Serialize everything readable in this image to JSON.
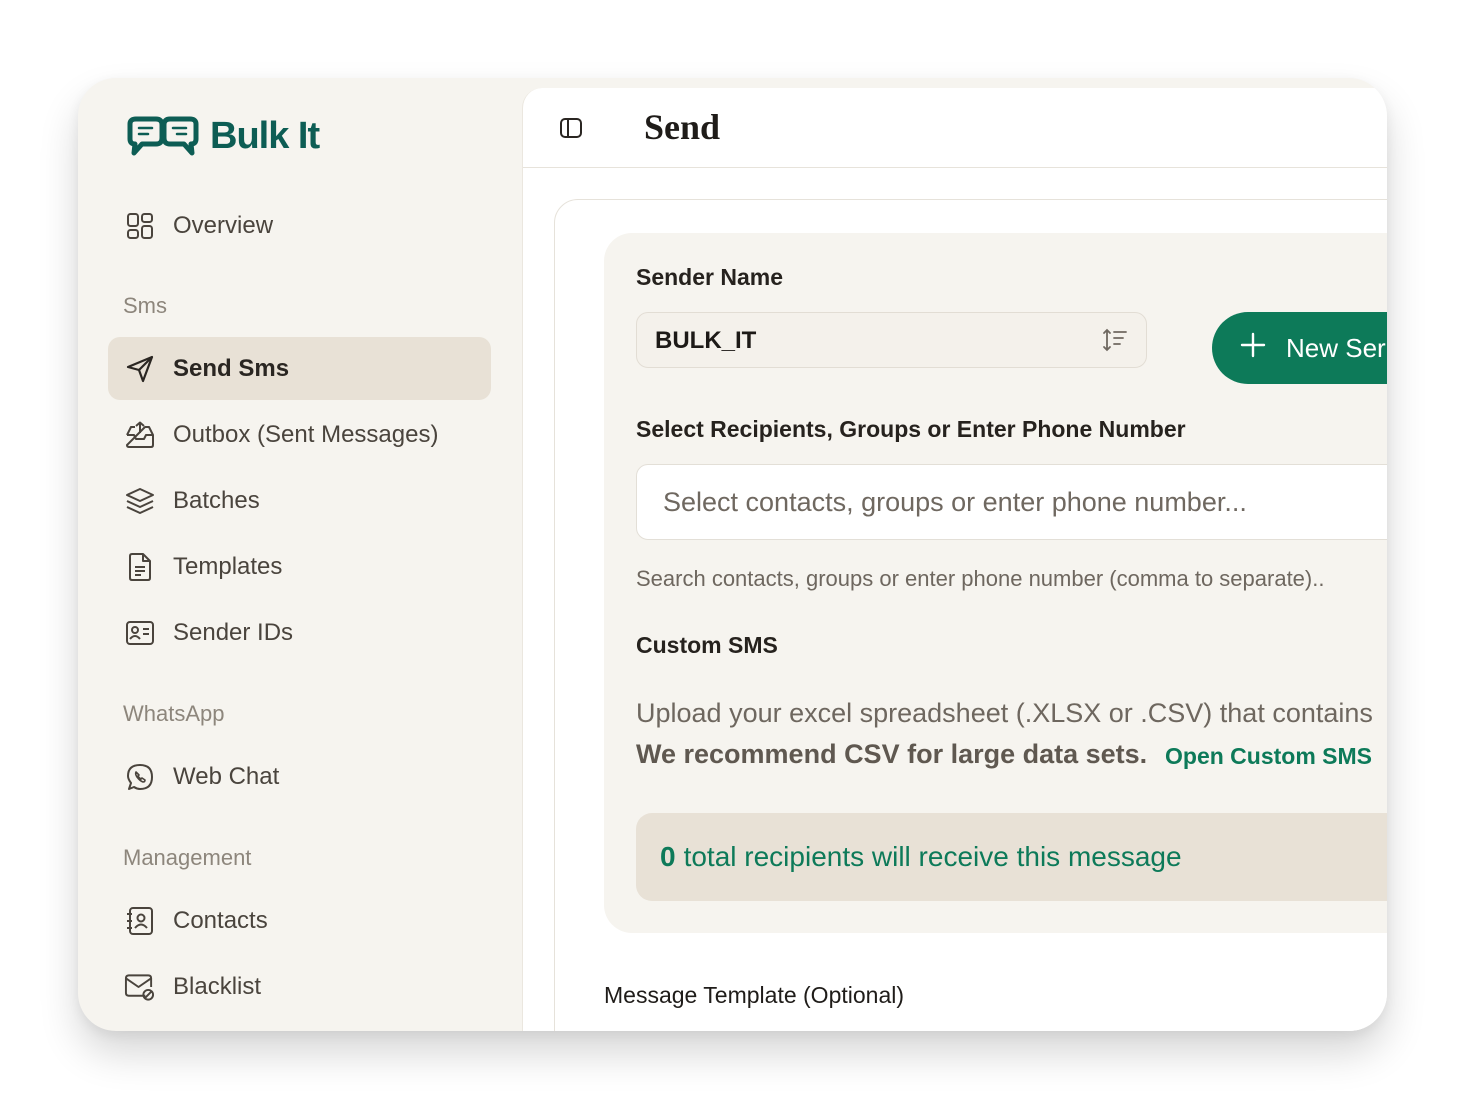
{
  "app": {
    "name": "Bulk It",
    "brand_color": "#0d5d54",
    "accent_color": "#0d7a59"
  },
  "sidebar": {
    "overview": {
      "label": "Overview",
      "icon": "grid-icon"
    },
    "sections": {
      "sms": "Sms",
      "whatsapp": "WhatsApp",
      "management": "Management"
    },
    "sms_items": [
      {
        "label": "Send Sms",
        "icon": "send-icon",
        "active": true
      },
      {
        "label": "Outbox (Sent Messages)",
        "icon": "outbox-icon"
      },
      {
        "label": "Batches",
        "icon": "layers-icon"
      },
      {
        "label": "Templates",
        "icon": "document-icon"
      },
      {
        "label": "Sender IDs",
        "icon": "id-card-icon"
      }
    ],
    "whatsapp_items": [
      {
        "label": "Web Chat",
        "icon": "whatsapp-icon"
      }
    ],
    "management_items": [
      {
        "label": "Contacts",
        "icon": "contacts-icon"
      },
      {
        "label": "Blacklist",
        "icon": "blacklist-icon"
      }
    ]
  },
  "header": {
    "title": "Send"
  },
  "form": {
    "sender_name_label": "Sender Name",
    "sender_name_value": "BULK_IT",
    "new_sender_label": "New Ser",
    "recipients_label": "Select Recipients, Groups or Enter Phone Number",
    "recipients_placeholder": "Select contacts, groups or enter phone number...",
    "recipients_helper": "Search contacts, groups or enter phone number (comma to separate)..",
    "custom_sms_label": "Custom SMS",
    "upload_text": "Upload your excel spreadsheet (.XLSX or .CSV) that contains",
    "recommend_text": "We recommend CSV for large data sets.",
    "open_custom_sms": "Open Custom SMS",
    "recipients_count": "0",
    "recipients_summary": "total recipients will receive this message",
    "message_template_label": "Message Template (Optional)"
  }
}
